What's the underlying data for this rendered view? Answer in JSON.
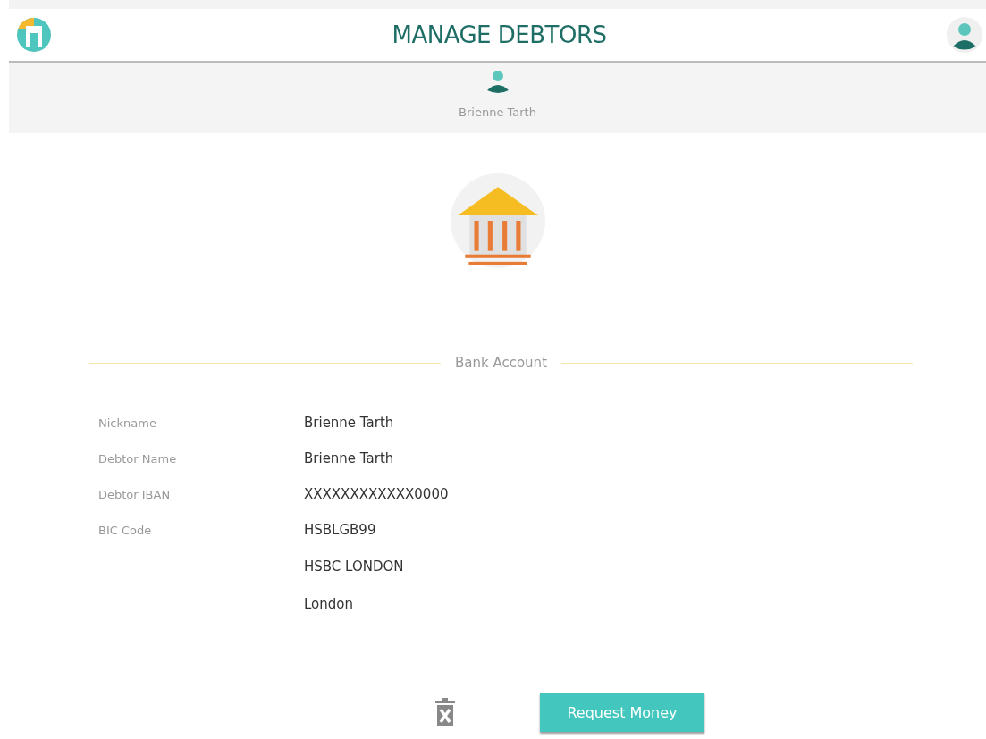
{
  "header": {
    "title": "MANAGE DEBTORS"
  },
  "debtor": {
    "name": "Brienne Tarth"
  },
  "section": {
    "title": "Bank Account"
  },
  "fields": [
    {
      "label": "Nickname",
      "value": "Brienne Tarth"
    },
    {
      "label": "Debtor Name",
      "value": "Brienne Tarth"
    },
    {
      "label": "Debtor IBAN",
      "value": "XXXXXXXXXXXX0000"
    },
    {
      "label": "BIC Code",
      "value": "HSBLGB99"
    },
    {
      "value": "HSBC LONDON"
    },
    {
      "value": "London"
    }
  ],
  "actions": {
    "primary": "Request Money"
  }
}
